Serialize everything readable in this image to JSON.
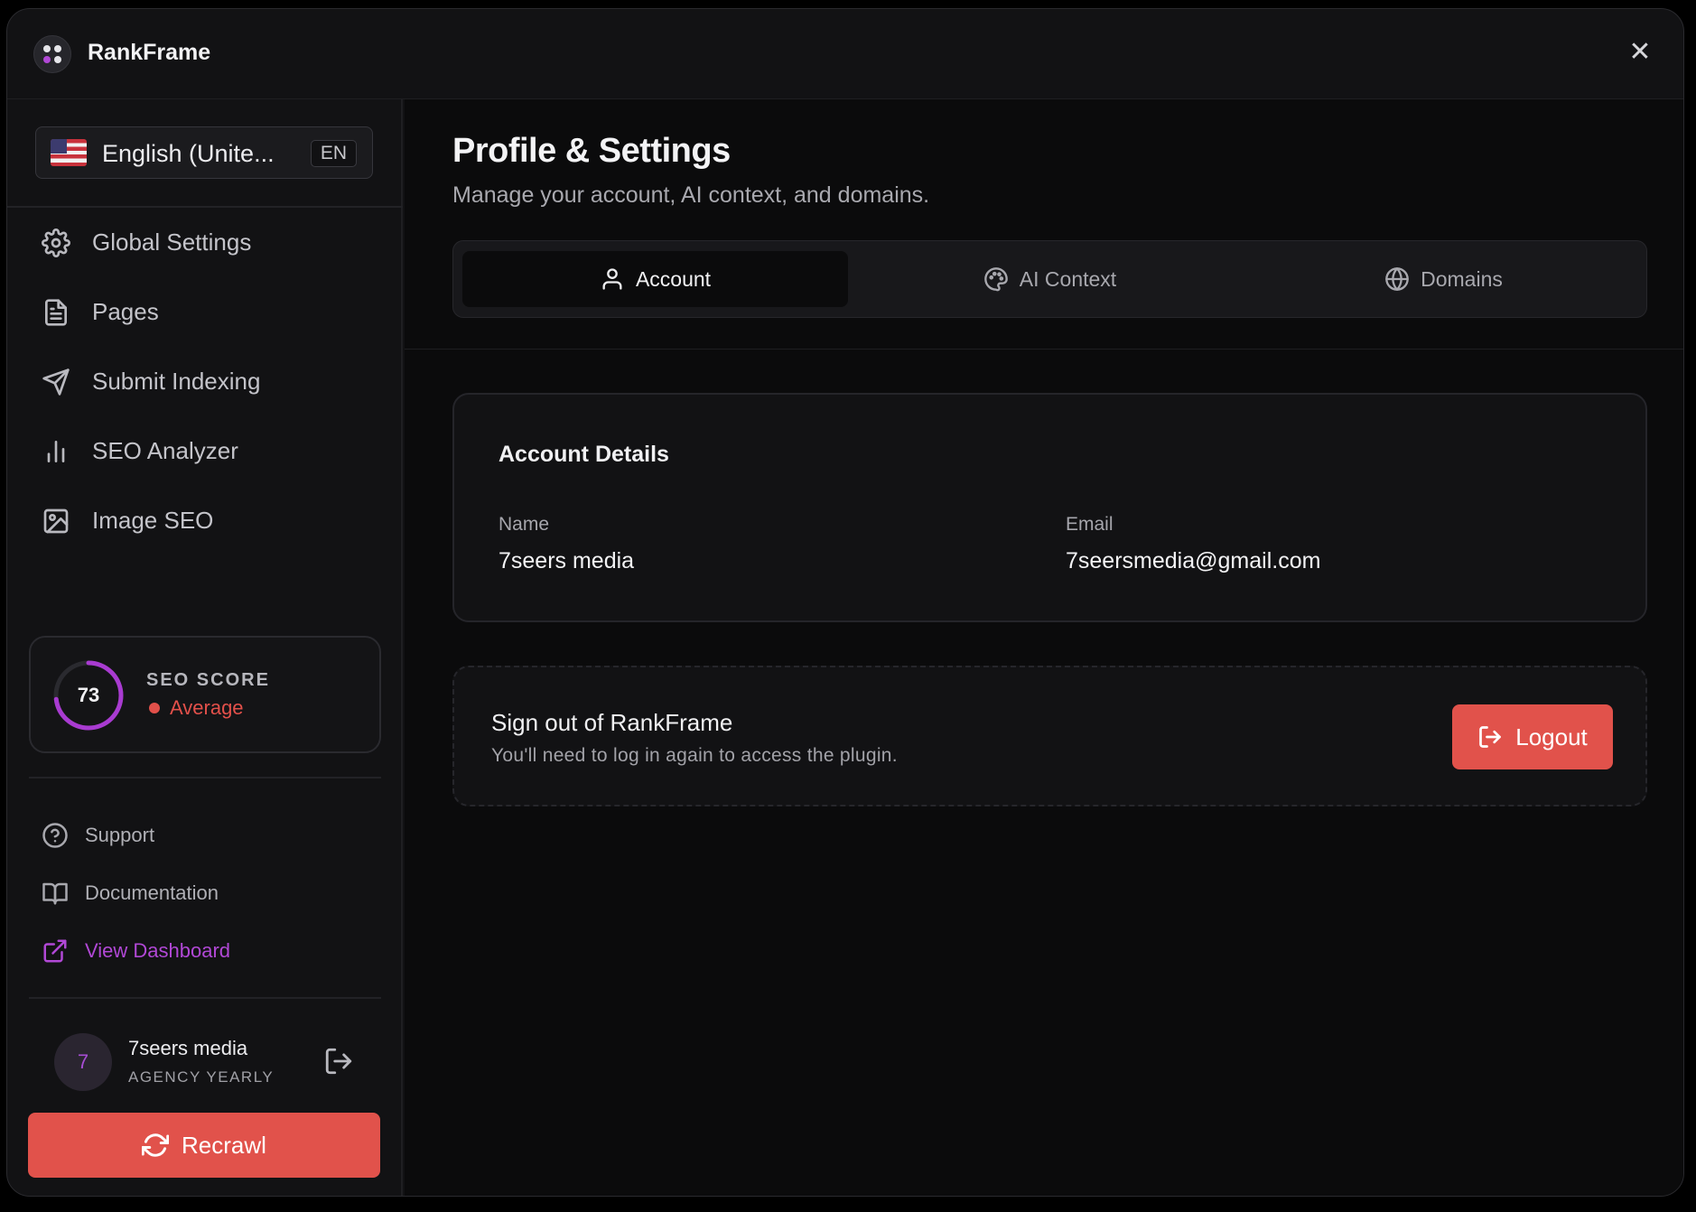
{
  "app": {
    "brand": "RankFrame",
    "close_label": "✕"
  },
  "language": {
    "label": "English (Unite...",
    "code": "EN"
  },
  "nav": [
    {
      "label": "Global Settings",
      "icon": "gear-icon"
    },
    {
      "label": "Pages",
      "icon": "document-icon"
    },
    {
      "label": "Submit Indexing",
      "icon": "send-icon"
    },
    {
      "label": "SEO Analyzer",
      "icon": "bar-chart-icon"
    },
    {
      "label": "Image SEO",
      "icon": "image-icon"
    }
  ],
  "seo_score": {
    "value": "73",
    "score_fraction": 0.73,
    "title": "SEO SCORE",
    "status": "Average",
    "ring_color": "#a93bd1",
    "status_color": "#e2504a"
  },
  "links": {
    "support": "Support",
    "documentation": "Documentation",
    "dashboard": "View Dashboard",
    "accent_color": "#b148d6"
  },
  "user": {
    "initial": "7",
    "name": "7seers media",
    "plan": "AGENCY YEARLY"
  },
  "recrawl_label": "Recrawl",
  "main": {
    "title": "Profile & Settings",
    "subtitle": "Manage your account, AI context, and domains.",
    "tabs": [
      {
        "label": "Account",
        "icon": "user-icon",
        "active": true
      },
      {
        "label": "AI Context",
        "icon": "palette-icon",
        "active": false
      },
      {
        "label": "Domains",
        "icon": "globe-icon",
        "active": false
      }
    ]
  },
  "account": {
    "title": "Account Details",
    "name_label": "Name",
    "name_value": "7seers media",
    "email_label": "Email",
    "email_value": "7seersmedia@gmail.com"
  },
  "signout": {
    "title": "Sign out of RankFrame",
    "subtitle": "You'll need to log in again to access the plugin.",
    "button": "Logout",
    "button_color": "#e1524b"
  }
}
